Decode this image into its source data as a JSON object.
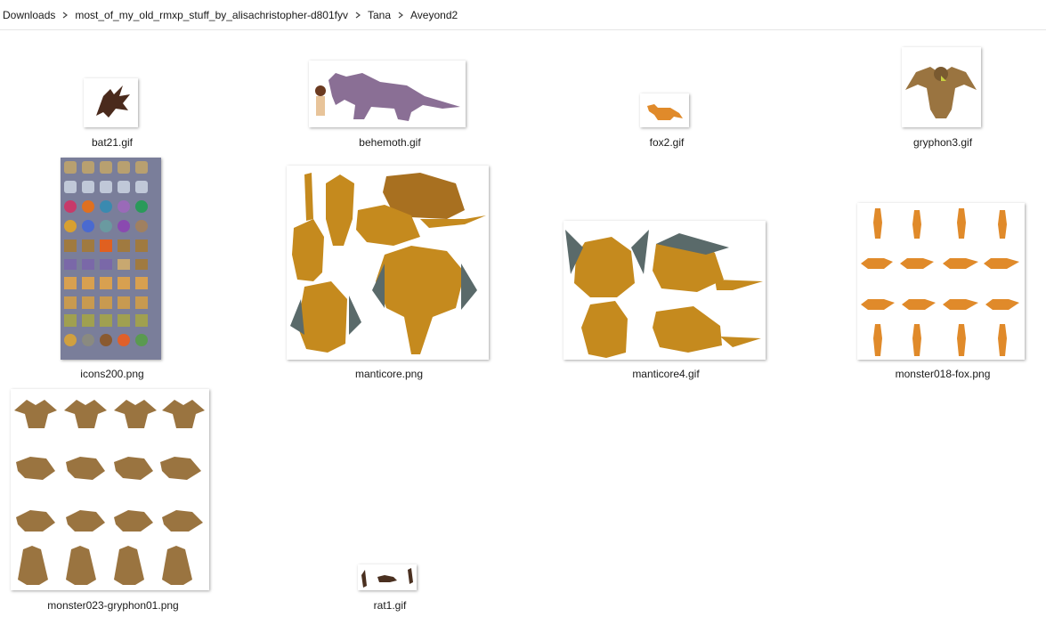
{
  "breadcrumb": [
    "Downloads",
    "most_of_my_old_rmxp_stuff_by_alisachristopher-d801fyv",
    "Tana",
    "Aveyond2"
  ],
  "files": [
    {
      "name": "bat21.gif",
      "icon": "bat-thumbnail"
    },
    {
      "name": "behemoth.gif",
      "icon": "behemoth-thumbnail"
    },
    {
      "name": "fox2.gif",
      "icon": "fox-thumbnail"
    },
    {
      "name": "gryphon3.gif",
      "icon": "gryphon-thumbnail"
    },
    {
      "name": "icons200.png",
      "icon": "icon-sheet-thumbnail"
    },
    {
      "name": "manticore.png",
      "icon": "manticore-sheet-thumbnail"
    },
    {
      "name": "manticore4.gif",
      "icon": "manticore-sheet-thumbnail"
    },
    {
      "name": "monster018-fox.png",
      "icon": "fox-sheet-thumbnail"
    },
    {
      "name": "monster023-gryphon01.png",
      "icon": "gryphon-sheet-thumbnail"
    },
    {
      "name": "rat1.gif",
      "icon": "rat-thumbnail"
    }
  ],
  "colors": {
    "manticore": "#c58a1e",
    "gryphon": "#9a7440",
    "fox": "#e08a2a",
    "behemoth": "#8a6f95",
    "bat": "#4a2a1c",
    "icons_bg": "#7a7e9a"
  }
}
